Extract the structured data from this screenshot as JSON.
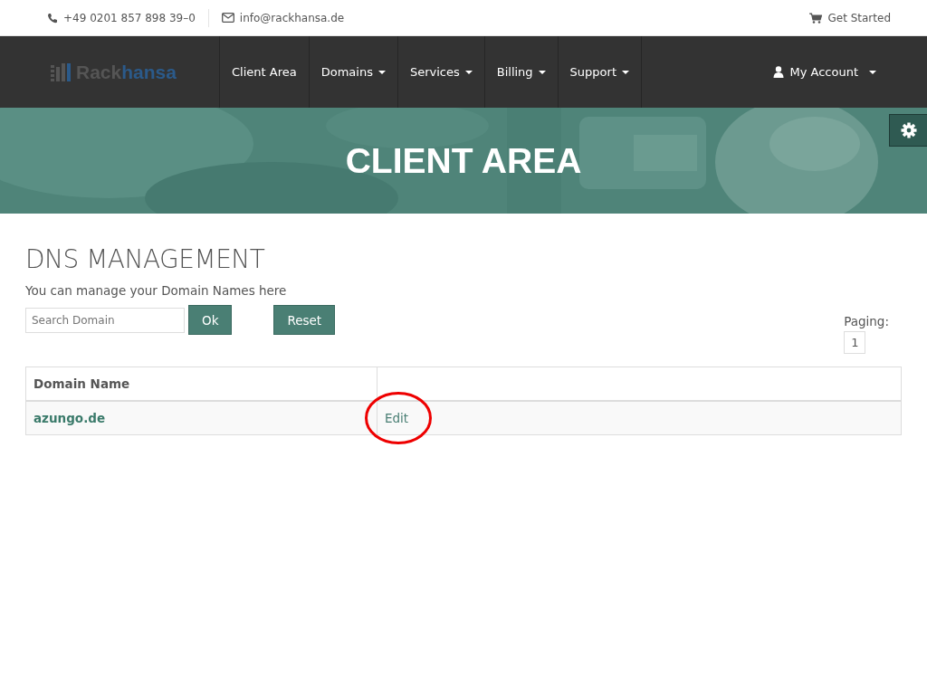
{
  "topbar": {
    "phone": "+49 0201 857 898 39–0",
    "email": "info@rackhansa.de",
    "cart_link": "Get Started"
  },
  "logo": {
    "part_1": "Rack",
    "part_2": "hansa"
  },
  "nav": [
    {
      "label": "Client Area",
      "dropdown": false
    },
    {
      "label": "Domains",
      "dropdown": true
    },
    {
      "label": "Services",
      "dropdown": true
    },
    {
      "label": "Billing",
      "dropdown": true
    },
    {
      "label": "Support",
      "dropdown": true
    }
  ],
  "account_menu": {
    "label": "My Account",
    "dropdown": true
  },
  "hero": {
    "title": "CLIENT AREA"
  },
  "page": {
    "title": "DNS MANAGEMENT",
    "subtitle": "You can manage your Domain Names here"
  },
  "search": {
    "placeholder": "Search Domain",
    "ok_button": "Ok",
    "reset_button": "Reset"
  },
  "paging": {
    "label": "Paging:",
    "pages": [
      {
        "label": "1",
        "selected": false
      }
    ]
  },
  "table": {
    "columns": [
      "Domain Name"
    ],
    "rows": [
      {
        "domain": "azungo.de",
        "action": "Edit",
        "annotation": {
          "kind": "circle"
        }
      }
    ]
  }
}
